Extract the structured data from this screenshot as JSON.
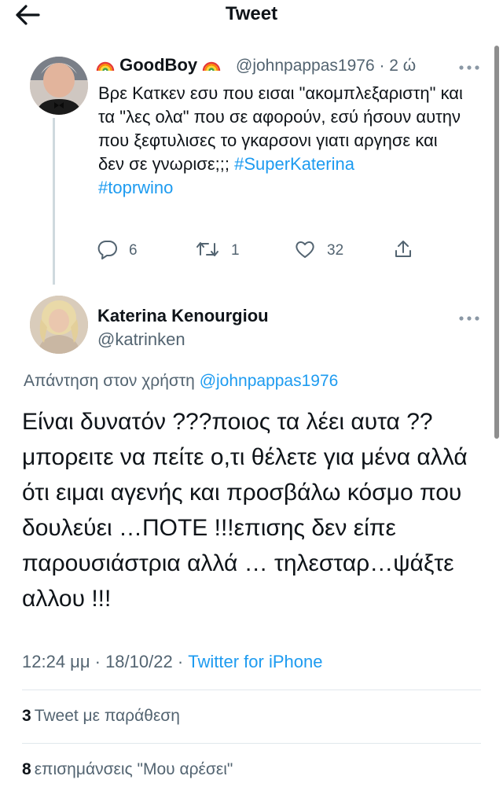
{
  "header": {
    "title": "Tweet"
  },
  "parent_tweet": {
    "display_name": "GoodBoy",
    "handle_time": "@johnpappas1976 · 2 ώ",
    "text_before": "Βρε Κατκεν εσυ που εισαι \"ακομπλεξαριστη\" και τα \"λες ολα\" που σε αφορούν, εσύ ήσουν αυτην που ξεφτυλισες το γκαρσονι γιατι αργησε και δεν σε γνωρισε;;; ",
    "hashtag_1": "#SuperKaterina",
    "hashtag_2": "#toprwino",
    "reply_count": "6",
    "retweet_count": "1",
    "like_count": "32"
  },
  "main_tweet": {
    "display_name": "Katerina Kenourgiou",
    "handle": "@katrinken",
    "replying_to_label": "Απάντηση στον χρήστη ",
    "replying_to_handle": "@johnpappas1976",
    "text": "Είναι δυνατόν ???ποιος τα λέει αυτα ?? μπορειτε να πείτε ο,τι θέλετε για μένα αλλά ότι ειμαι αγενής και προσβάλω κόσμο που δουλεύει …ΠΟΤΕ !!!επισης δεν είπε παρουσιάστρια αλλά … τηλεσταρ…ψάξτε αλλου !!!",
    "timestamp": "12:24 μμ · 18/10/22 · ",
    "source": "Twitter for iPhone",
    "quote_count": "3",
    "quote_label": "Tweet με παράθεση",
    "likes_count": "8",
    "likes_label": "επισημάνσεις \"Μου αρέσει\""
  },
  "colors": {
    "accent": "#1d9bf0",
    "secondary_text": "#536471",
    "divider": "#e1e8ed"
  }
}
